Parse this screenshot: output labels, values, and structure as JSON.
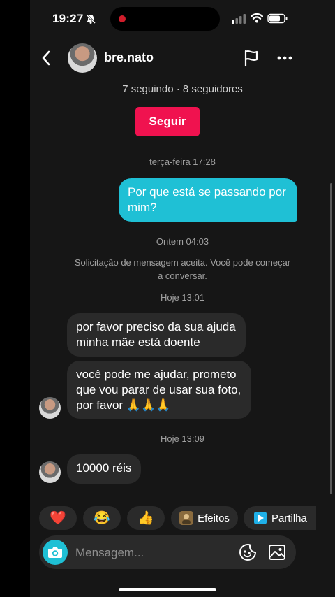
{
  "status": {
    "time": "19:27"
  },
  "header": {
    "username": "bre.nato"
  },
  "profile": {
    "follow_info": "7 seguindo · 8 seguidores",
    "follow_label": "Seguir"
  },
  "messages": {
    "ts1": "terça-feira 17:28",
    "out1": "Por que está se passando por mim?",
    "ts2": "Ontem 04:03",
    "system": "Solicitação de mensagem aceita. Você pode começar a conversar.",
    "ts3": "Hoje 13:01",
    "in1": "por favor preciso da sua ajuda minha mãe está doente",
    "in2": "você pode me ajudar, prometo que vou parar de usar sua foto, por favor 🙏🙏🙏",
    "ts4": "Hoje 13:09",
    "in3": "10000 réis"
  },
  "quick": {
    "heart": "❤️",
    "laugh": "😂",
    "thumbs": "👍",
    "effects_label": "Efeitos",
    "share_label": "Partilha"
  },
  "composer": {
    "placeholder": "Mensagem..."
  },
  "colors": {
    "accent_pink": "#f0124f",
    "bubble_teal": "#1fc0d5",
    "background": "#161616"
  }
}
